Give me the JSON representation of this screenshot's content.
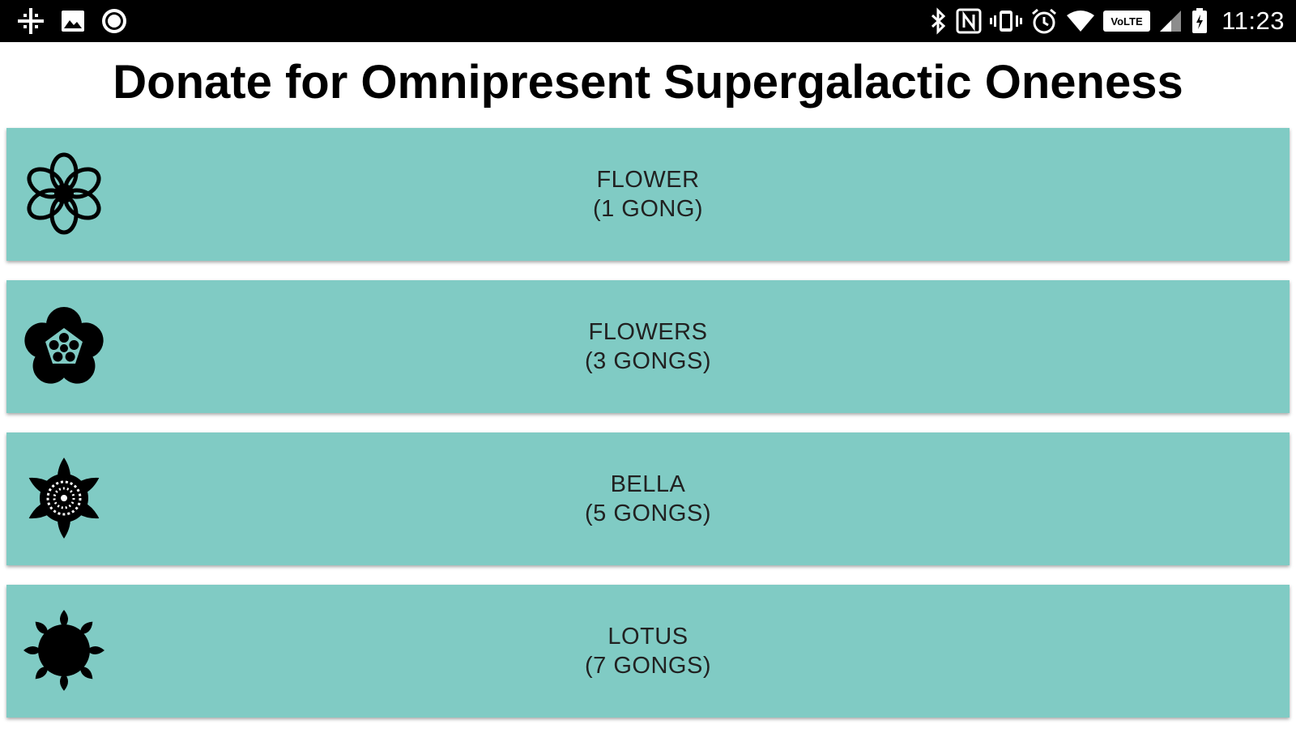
{
  "status_bar": {
    "left_icons": [
      "grid-icon",
      "image-icon",
      "record-icon"
    ],
    "right_icons": [
      "bluetooth-icon",
      "nfc-icon",
      "vibrate-icon",
      "alarm-icon",
      "wifi-icon",
      "volte-icon",
      "signal-icon",
      "battery-icon"
    ],
    "volte_label": "VoLTE",
    "time": "11:23"
  },
  "page": {
    "title": "Donate for Omnipresent Supergalactic Oneness"
  },
  "donations": [
    {
      "name": "FLOWER",
      "price": "(1 GONG)",
      "icon": "flower-icon"
    },
    {
      "name": "FLOWERS",
      "price": "(3 GONGS)",
      "icon": "flowers-icon"
    },
    {
      "name": "BELLA",
      "price": "(5 GONGS)",
      "icon": "bella-icon"
    },
    {
      "name": "LOTUS",
      "price": "(7 GONGS)",
      "icon": "lotus-icon"
    }
  ],
  "colors": {
    "status_bar": "#000000",
    "button_background": "#80cbc4",
    "title_text": "#000000",
    "button_text": "#212121"
  }
}
